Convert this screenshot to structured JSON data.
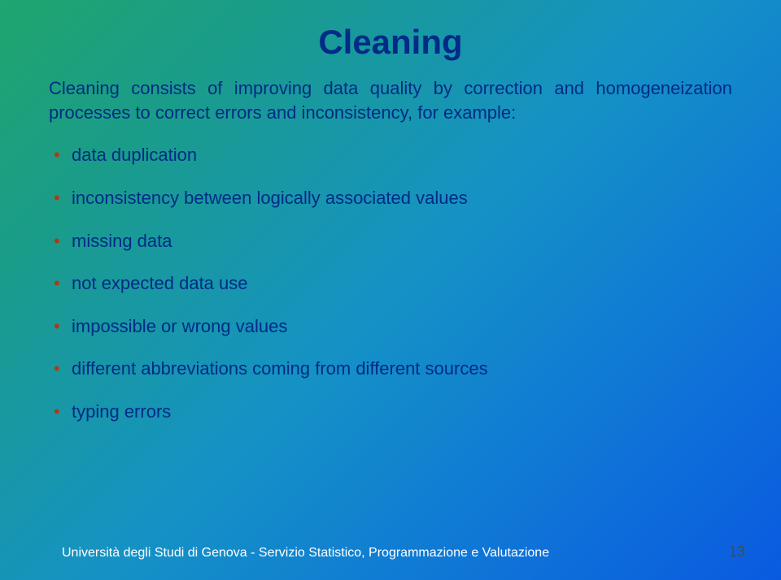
{
  "title": "Cleaning",
  "intro": "Cleaning consists of improving data quality by correction and homogeneization processes to correct errors and inconsistency, for example:",
  "bullets": [
    "data duplication",
    "inconsistency between logically associated values",
    "missing data",
    "not expected data use",
    "impossible or wrong values",
    "different abbreviations coming from different sources",
    "typing errors"
  ],
  "footer": "Università degli Studi di Genova - Servizio Statistico, Programmazione e Valutazione",
  "page": "13"
}
